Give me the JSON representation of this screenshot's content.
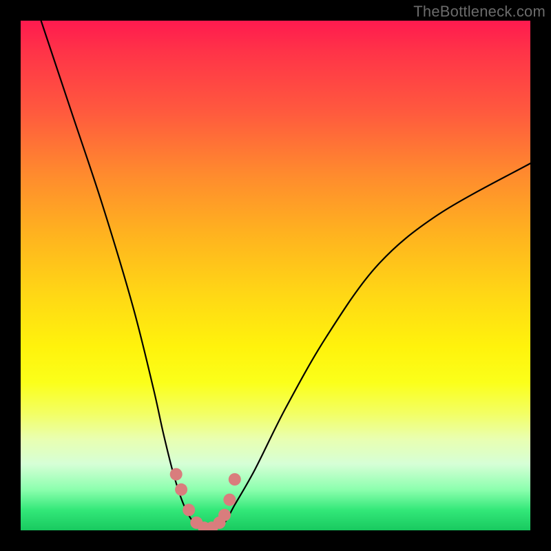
{
  "watermark": "TheBottleneck.com",
  "chart_data": {
    "type": "line",
    "title": "",
    "xlabel": "",
    "ylabel": "",
    "xlim": [
      0,
      100
    ],
    "ylim": [
      0,
      100
    ],
    "series": [
      {
        "name": "bottleneck-curve",
        "x": [
          4,
          10,
          16,
          22,
          26,
          28,
          30,
          32,
          34,
          36,
          38,
          40,
          42,
          46,
          52,
          60,
          70,
          82,
          100
        ],
        "values": [
          100,
          82,
          64,
          44,
          28,
          19,
          11,
          5,
          1.5,
          0.5,
          0.5,
          1.5,
          5,
          12,
          24,
          38,
          52,
          62,
          72
        ]
      }
    ],
    "markers": {
      "name": "highlight-dots",
      "color": "#d97d7d",
      "x": [
        30.5,
        31.5,
        33.0,
        34.5,
        36.0,
        37.5,
        39.0,
        40.0,
        41.0,
        42.0
      ],
      "values": [
        11,
        8,
        4,
        1.5,
        0.5,
        0.5,
        1.5,
        3,
        6,
        10
      ]
    },
    "background_gradient": {
      "top": "#ff1a4f",
      "mid": "#fff30c",
      "bottom": "#18c95f",
      "direction": "vertical"
    },
    "frame_color": "#000000"
  }
}
